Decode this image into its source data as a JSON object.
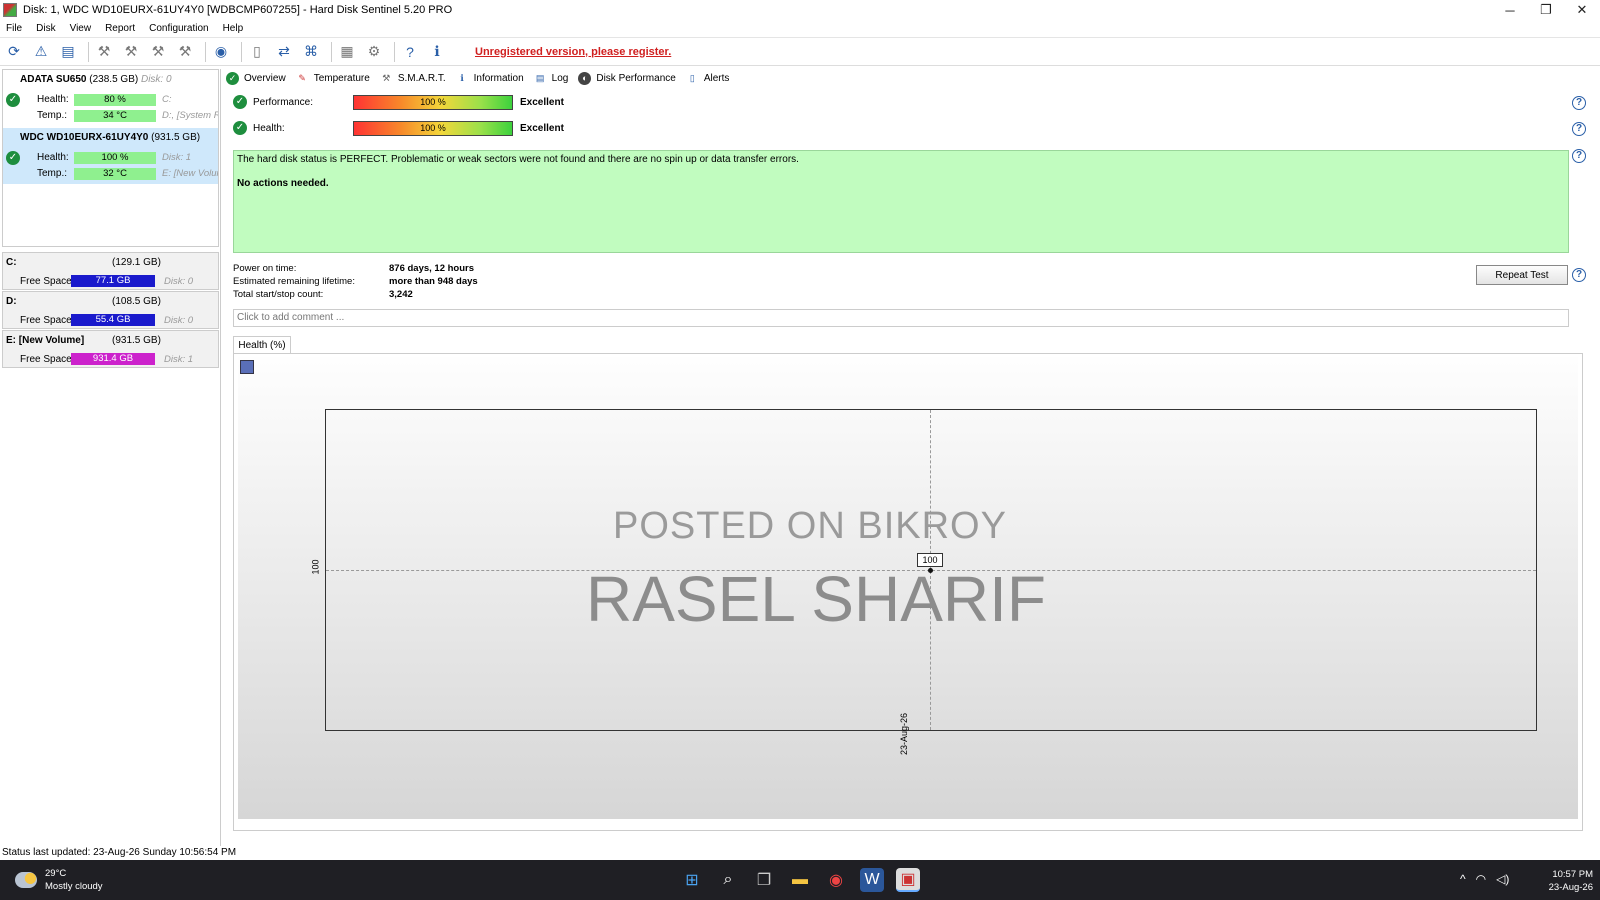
{
  "window": {
    "title": "Disk: 1, WDC WD10EURX-61UY4Y0 [WDBCMP607255]  -  Hard Disk Sentinel 5.20 PRO",
    "controls": {
      "minimize": "─",
      "maximize": "❐",
      "close": "✕"
    }
  },
  "menu": [
    "File",
    "Disk",
    "View",
    "Report",
    "Configuration",
    "Help"
  ],
  "toolbar": {
    "register_text": "Unregistered version, please register."
  },
  "disks": [
    {
      "name": "ADATA SU650",
      "size": "(238.5 GB)",
      "disk_no": "Disk: 0",
      "health_label": "Health:",
      "health": "80 %",
      "health_pct": 80,
      "temp_label": "Temp.:",
      "temp": "34 °C",
      "drive1": "C:",
      "drive2": "D:, [System R"
    },
    {
      "name": "WDC WD10EURX-61UY4Y0",
      "size": "(931.5 GB)",
      "disk_no": "",
      "health_label": "Health:",
      "health": "100 %",
      "health_pct": 100,
      "temp_label": "Temp.:",
      "temp": "32 °C",
      "drive1": "Disk: 1",
      "drive2": "E: [New Volur"
    }
  ],
  "volumes": [
    {
      "name": "C:",
      "size": "(129.1 GB)",
      "free_label": "Free Space",
      "free": "77.1 GB",
      "disk": "Disk: 0",
      "color": "#1a1acc"
    },
    {
      "name": "D:",
      "size": "(108.5 GB)",
      "free_label": "Free Space",
      "free": "55.4 GB",
      "disk": "Disk: 0",
      "color": "#1a1acc"
    },
    {
      "name": "E: [New Volume]",
      "size": "(931.5 GB)",
      "free_label": "Free Space",
      "free": "931.4 GB",
      "disk": "Disk: 1",
      "color": "#cc22cc"
    }
  ],
  "tabs": [
    "Overview",
    "Temperature",
    "S.M.A.R.T.",
    "Information",
    "Log",
    "Disk Performance",
    "Alerts"
  ],
  "overview": {
    "performance_label": "Performance:",
    "performance_value": "100 %",
    "performance_rating": "Excellent",
    "health_label": "Health:",
    "health_value": "100 %",
    "health_rating": "Excellent",
    "status_message": "The hard disk status is PERFECT. Problematic or weak sectors were not found and there are no spin up or data transfer errors.",
    "action": "No actions needed.",
    "power_on_label": "Power on time:",
    "power_on_value": "876 days, 12 hours",
    "lifetime_label": "Estimated remaining lifetime:",
    "lifetime_value": "more than 948 days",
    "startstop_label": "Total start/stop count:",
    "startstop_value": "3,242",
    "repeat_button": "Repeat Test",
    "comment_placeholder": "Click to add comment ..."
  },
  "graph": {
    "tab_label": "Health (%)",
    "watermark_line1": "POSTED ON BIKROY",
    "watermark_line2": "RASEL SHARIF"
  },
  "chart_data": {
    "type": "line",
    "x": [
      "23-Aug-26"
    ],
    "series": [
      {
        "values": [
          100
        ]
      }
    ],
    "y_tick_labels": [
      "100"
    ],
    "data_labels": [
      "100"
    ],
    "grid": false
  },
  "statusbar": "Status last updated: 23-Aug-26 Sunday 10:56:54 PM",
  "taskbar": {
    "temperature": "29°C",
    "weather": "Mostly cloudy",
    "time": "10:57 PM",
    "date": "23-Aug-26"
  }
}
